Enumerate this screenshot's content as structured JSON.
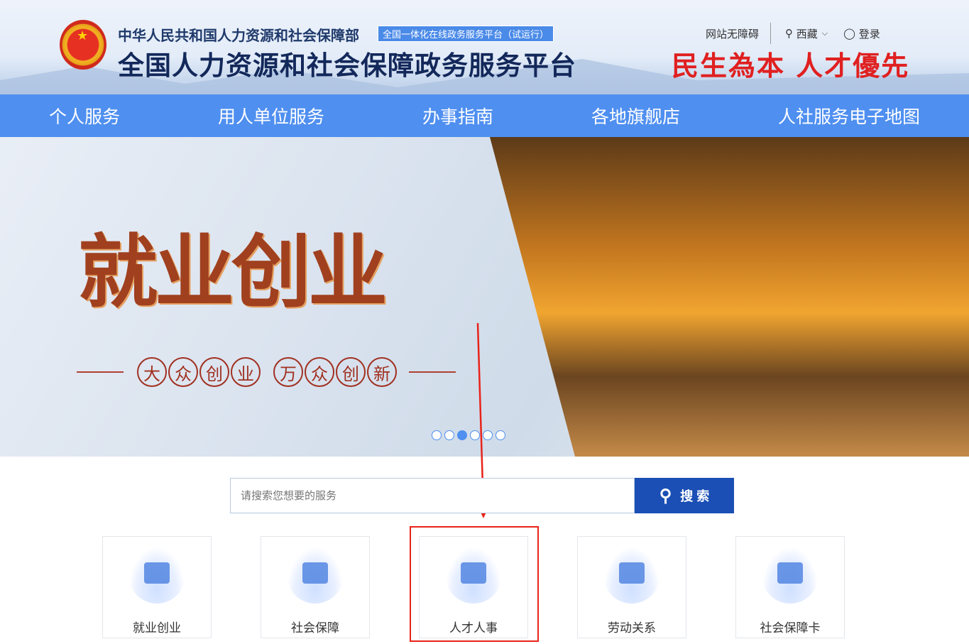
{
  "header": {
    "ministry": "中华人民共和国人力资源和社会保障部",
    "badge": "全国一体化在线政务服务平台（试运行）",
    "title": "全国人力资源和社会保障政务服务平台",
    "accessibility": "网站无障碍",
    "region": "西藏",
    "login": "登录",
    "slogan": "民生為本 人才優先"
  },
  "nav": [
    "个人服务",
    "用人单位服务",
    "办事指南",
    "各地旗舰店",
    "人社服务电子地图"
  ],
  "banner": {
    "headline": "就业创业",
    "circles1": [
      "大",
      "众",
      "创",
      "业"
    ],
    "circles2": [
      "万",
      "众",
      "创",
      "新"
    ],
    "slides": 6,
    "active_slide": 3
  },
  "search": {
    "placeholder": "请搜索您想要的服务",
    "button": "搜 索"
  },
  "cards": [
    "就业创业",
    "社会保障",
    "人才人事",
    "劳动关系",
    "社会保障卡"
  ],
  "colors": {
    "nav": "#4f8ff0",
    "search_button": "#1b4fb5",
    "highlight": "#e8231a"
  }
}
